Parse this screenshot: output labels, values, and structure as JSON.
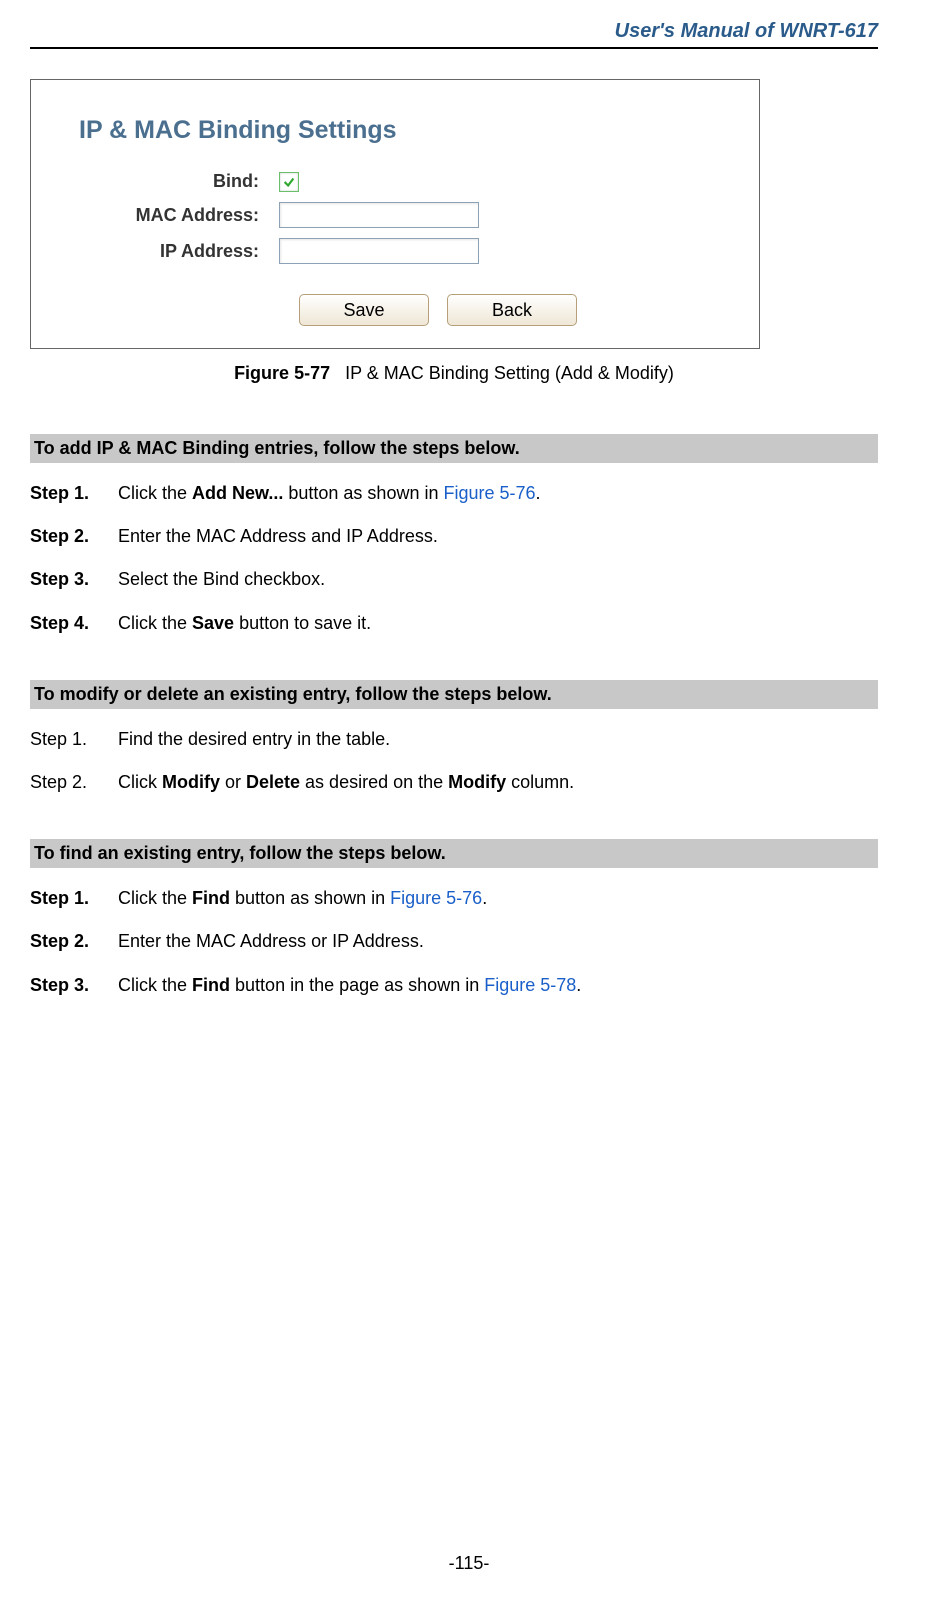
{
  "header": {
    "title": "User's Manual of WNRT-617"
  },
  "figure": {
    "panel_title": "IP & MAC Binding Settings",
    "labels": {
      "bind": "Bind:",
      "mac": "MAC Address:",
      "ip": "IP Address:"
    },
    "fields": {
      "mac_value": "",
      "ip_value": "",
      "bind_checked": true
    },
    "buttons": {
      "save": "Save",
      "back": "Back"
    },
    "caption_bold": "Figure 5-77",
    "caption_rest": "IP & MAC Binding Setting (Add & Modify)"
  },
  "section1": {
    "title": "To add IP & MAC Binding entries, follow the steps below.",
    "step1_label": "Step 1.",
    "step1": {
      "t1": "Click the ",
      "b1": "Add New...",
      "t2": " button as shown in ",
      "link": "Figure 5-76",
      "t3": "."
    },
    "step2_label": "Step 2.",
    "step2_text": "Enter the MAC Address and IP Address.",
    "step3_label": "Step 3.",
    "step3_text": "Select the Bind checkbox.",
    "step4_label": "Step 4.",
    "step4": {
      "t1": "Click the ",
      "b1": "Save",
      "t2": " button to save it."
    }
  },
  "section2": {
    "title": "To modify or delete an existing entry, follow the steps below.",
    "step1_label": "Step 1.",
    "step1_text": "Find the desired entry in the table.",
    "step2_label": "Step 2.",
    "step2": {
      "t1": "Click ",
      "b1": "Modify",
      "t2": " or ",
      "b2": "Delete",
      "t3": " as desired on the ",
      "b3": "Modify",
      "t4": " column."
    }
  },
  "section3": {
    "title": "To find an existing entry, follow the steps below.",
    "step1_label": "Step 1.",
    "step1": {
      "t1": "Click the ",
      "b1": "Find",
      "t2": " button as shown in ",
      "link": "Figure 5-76",
      "t3": "."
    },
    "step2_label": "Step 2.",
    "step2_text": "Enter the MAC Address or IP Address.",
    "step3_label": "Step 3.",
    "step3": {
      "t1": "Click the ",
      "b1": "Find",
      "t2": " button in the page as shown in ",
      "link": "Figure 5-78",
      "t3": "."
    }
  },
  "page_number": "-115-"
}
